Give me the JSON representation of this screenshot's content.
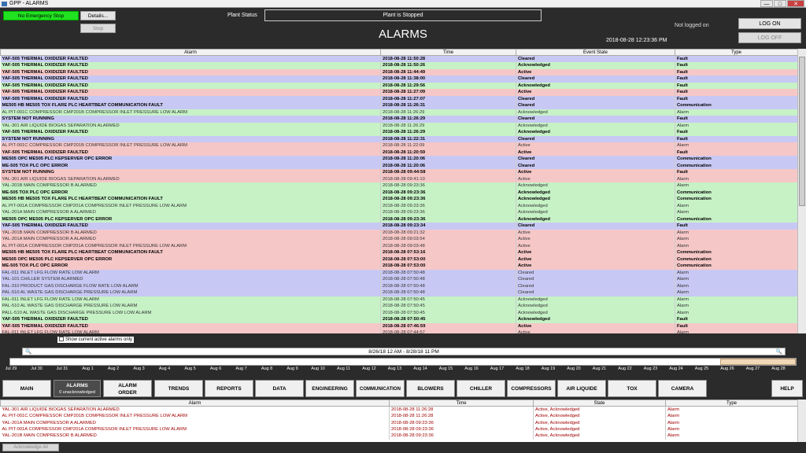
{
  "window": {
    "title": "GPP - ALARMS",
    "min": "—",
    "max": "□",
    "close": "✕"
  },
  "header": {
    "estop": "No Emergency Stop",
    "details": "Details...",
    "stop": "Stop",
    "plant_status_label": "Plant Status",
    "plant_status": "Plant is Stopped",
    "title": "ALARMS",
    "datetime": "2018-08-28 12:23:36 PM",
    "login_status": "Not logged on",
    "log_on": "LOG ON",
    "log_off": "LOG OFF"
  },
  "alarm_table": {
    "columns": [
      "Alarm",
      "Time",
      "Event State",
      "Type"
    ],
    "rows": [
      {
        "alarm": "YAF-505 THERMAL OXIDIZER FAULTED",
        "time": "2018-08-28 11:50:28",
        "state": "Cleared",
        "type": "Fault",
        "c": "clr",
        "b": 1
      },
      {
        "alarm": "YAF-505 THERMAL OXIDIZER FAULTED",
        "time": "2018-08-28 11:50:26",
        "state": "Acknowledged",
        "type": "Fault",
        "c": "ack",
        "b": 1
      },
      {
        "alarm": "YAF-505 THERMAL OXIDIZER FAULTED",
        "time": "2018-08-28 11:44:49",
        "state": "Active",
        "type": "Fault",
        "c": "act",
        "b": 1
      },
      {
        "alarm": "YAF-505 THERMAL OXIDIZER FAULTED",
        "time": "2018-08-28 11:38:00",
        "state": "Cleared",
        "type": "Fault",
        "c": "clr",
        "b": 1
      },
      {
        "alarm": "YAF-505 THERMAL OXIDIZER FAULTED",
        "time": "2018-08-28 11:29:56",
        "state": "Acknowledged",
        "type": "Fault",
        "c": "ack",
        "b": 1
      },
      {
        "alarm": "YAF-505 THERMAL OXIDIZER FAULTED",
        "time": "2018-08-28 11:27:09",
        "state": "Active",
        "type": "Fault",
        "c": "act",
        "b": 1
      },
      {
        "alarm": "YAF-505 THERMAL OXIDIZER FAULTED",
        "time": "2018-08-28 11:27:07",
        "state": "Cleared",
        "type": "Fault",
        "c": "clr",
        "b": 1
      },
      {
        "alarm": "ME505 HB ME505 TOX FLARE PLC HEARTBEAT COMMUNICATION FAULT",
        "time": "2018-08-28 11:26:31",
        "state": "Cleared",
        "type": "Communication",
        "c": "clr",
        "b": 1
      },
      {
        "alarm": "AL PIT-001C COMPRESSOR CMP201B COMPRESSOR INLET PRESSURE LOW ALARM",
        "time": "2018-08-28 11:26:29",
        "state": "Acknowledged",
        "type": "Alarm",
        "c": "ack",
        "b": 0
      },
      {
        "alarm": "SYSTEM NOT RUNNING",
        "time": "2018-08-28 11:26:29",
        "state": "Cleared",
        "type": "Fault",
        "c": "clr",
        "b": 1
      },
      {
        "alarm": "YAL-301 AIR LIQUIDE BIOGAS SEPARATION ALARMED",
        "time": "2018-08-28 11:26:29",
        "state": "Acknowledged",
        "type": "Alarm",
        "c": "ack",
        "b": 0
      },
      {
        "alarm": "YAF-505 THERMAL OXIDIZER FAULTED",
        "time": "2018-08-28 11:26:29",
        "state": "Acknowledged",
        "type": "Fault",
        "c": "ack",
        "b": 1
      },
      {
        "alarm": "SYSTEM NOT RUNNING",
        "time": "2018-08-28 11:22:31",
        "state": "Cleared",
        "type": "Fault",
        "c": "clr",
        "b": 1
      },
      {
        "alarm": "AL PIT-001C COMPRESSOR CMP201B COMPRESSOR INLET PRESSURE LOW ALARM",
        "time": "2018-08-28 11:22:09",
        "state": "Active",
        "type": "Alarm",
        "c": "act",
        "b": 0
      },
      {
        "alarm": "YAF-505 THERMAL OXIDIZER FAULTED",
        "time": "2018-08-28 11:20:59",
        "state": "Active",
        "type": "Fault",
        "c": "act",
        "b": 1
      },
      {
        "alarm": "ME505 OPC ME505 PLC KEPSERVER OPC ERROR",
        "time": "2018-08-28 11:20:06",
        "state": "Cleared",
        "type": "Communication",
        "c": "clr",
        "b": 1
      },
      {
        "alarm": "ME-505 TOX PLC OPC ERROR",
        "time": "2018-08-28 11:20:06",
        "state": "Cleared",
        "type": "Communication",
        "c": "clr",
        "b": 1
      },
      {
        "alarm": "SYSTEM NOT RUNNING",
        "time": "2018-08-28 09:44:58",
        "state": "Active",
        "type": "Fault",
        "c": "act",
        "b": 1
      },
      {
        "alarm": "YAL-301 AIR LIQUIDE BIOGAS SEPARATION ALARMED",
        "time": "2018-08-28 09:41:10",
        "state": "Active",
        "type": "Alarm",
        "c": "act",
        "b": 0
      },
      {
        "alarm": "YAL-201B MAIN COMPRESSOR B ALARMED",
        "time": "2018-08-28 09:23:36",
        "state": "Acknowledged",
        "type": "Alarm",
        "c": "ack",
        "b": 0
      },
      {
        "alarm": "ME-505 TOX PLC OPC ERROR",
        "time": "2018-08-28 09:23:36",
        "state": "Acknowledged",
        "type": "Communication",
        "c": "ack",
        "b": 1
      },
      {
        "alarm": "ME505 HB ME505 TOX FLARE PLC HEARTBEAT COMMUNICATION FAULT",
        "time": "2018-08-28 09:23:36",
        "state": "Acknowledged",
        "type": "Communication",
        "c": "ack",
        "b": 1
      },
      {
        "alarm": "AL PIT-001A COMPRESSOR CMP201A COMPRESSOR INLET PRESSURE LOW ALARM",
        "time": "2018-08-28 09:23:36",
        "state": "Acknowledged",
        "type": "Alarm",
        "c": "ack",
        "b": 0
      },
      {
        "alarm": "YAL-201A MAIN COMPRESSOR A ALARMED",
        "time": "2018-08-28 09:23:36",
        "state": "Acknowledged",
        "type": "Alarm",
        "c": "ack",
        "b": 0
      },
      {
        "alarm": "ME505 OPC ME505 PLC KEPSERVER OPC ERROR",
        "time": "2018-08-28 09:23:36",
        "state": "Acknowledged",
        "type": "Communication",
        "c": "ack",
        "b": 1
      },
      {
        "alarm": "YAF-505 THERMAL OXIDIZER FAULTED",
        "time": "2018-08-28 09:23:34",
        "state": "Cleared",
        "type": "Fault",
        "c": "clr",
        "b": 1
      },
      {
        "alarm": "YAL-201B MAIN COMPRESSOR B ALARMED",
        "time": "2018-08-28 09:21:32",
        "state": "Active",
        "type": "Alarm",
        "c": "act",
        "b": 0
      },
      {
        "alarm": "YAL-201A MAIN COMPRESSOR A ALARMED",
        "time": "2018-08-28 09:03:54",
        "state": "Active",
        "type": "Alarm",
        "c": "act",
        "b": 0
      },
      {
        "alarm": "AL PIT-001A COMPRESSOR CMP201A COMPRESSOR INLET PRESSURE LOW ALARM",
        "time": "2018-08-28 09:03:48",
        "state": "Active",
        "type": "Alarm",
        "c": "act",
        "b": 0
      },
      {
        "alarm": "ME505 HB ME505 TOX FLARE PLC HEARTBEAT COMMUNICATION FAULT",
        "time": "2018-08-28 07:53:16",
        "state": "Active",
        "type": "Communication",
        "c": "act",
        "b": 1
      },
      {
        "alarm": "ME505 OPC ME505 PLC KEPSERVER OPC ERROR",
        "time": "2018-08-28 07:53:00",
        "state": "Active",
        "type": "Communication",
        "c": "act",
        "b": 1
      },
      {
        "alarm": "ME-505 TOX PLC OPC ERROR",
        "time": "2018-08-28 07:53:00",
        "state": "Active",
        "type": "Communication",
        "c": "act",
        "b": 1
      },
      {
        "alarm": "FAL-011 INLET LFG FLOW RATE LOW ALARM",
        "time": "2018-08-28 07:50:48",
        "state": "Cleared",
        "type": "Alarm",
        "c": "clr",
        "b": 0
      },
      {
        "alarm": "YAL-101 CHILLER SYSTEM ALARMED",
        "time": "2018-08-28 07:50:48",
        "state": "Cleared",
        "type": "Alarm",
        "c": "clr",
        "b": 0
      },
      {
        "alarm": "FAL-310 PRODUCT GAS DISCHARGE FLOW RATE  LOW ALARM",
        "time": "2018-08-28 07:50:48",
        "state": "Cleared",
        "type": "Alarm",
        "c": "clr",
        "b": 0
      },
      {
        "alarm": "PAL-510 AL WASTE GAS DISCHARGE PRESSURE  LOW ALARM",
        "time": "2018-08-28 07:50:48",
        "state": "Cleared",
        "type": "Alarm",
        "c": "clr",
        "b": 0
      },
      {
        "alarm": "FAL-011 INLET LFG FLOW RATE LOW ALARM",
        "time": "2018-08-28 07:50:45",
        "state": "Acknowledged",
        "type": "Alarm",
        "c": "ack",
        "b": 0
      },
      {
        "alarm": "PAL-510 AL WASTE GAS DISCHARGE PRESSURE  LOW ALARM",
        "time": "2018-08-28 07:50:45",
        "state": "Acknowledged",
        "type": "Alarm",
        "c": "ack",
        "b": 0
      },
      {
        "alarm": "PALL-510 AL WASTE GAS DISCHARGE PRESSURE  LOW LOW ALARM",
        "time": "2018-08-28 07:50:45",
        "state": "Acknowledged",
        "type": "Alarm",
        "c": "ack",
        "b": 0
      },
      {
        "alarm": "YAF-505 THERMAL OXIDIZER FAULTED",
        "time": "2018-08-28 07:50:45",
        "state": "Acknowledged",
        "type": "Fault",
        "c": "ack",
        "b": 1
      },
      {
        "alarm": "YAF-505 THERMAL OXIDIZER FAULTED",
        "time": "2018-08-28 07:46:59",
        "state": "Active",
        "type": "Fault",
        "c": "act",
        "b": 1
      },
      {
        "alarm": "FAL-011 INLET LFG FLOW RATE LOW ALARM",
        "time": "2018-08-28 07:44:57",
        "state": "Active",
        "type": "Alarm",
        "c": "act",
        "b": 0
      }
    ]
  },
  "show_active_label": "Show current active alarms only",
  "time_range": "8/26/18 12 AM - 8/28/18 11 PM",
  "timeline_ticks": [
    "Jul 29",
    "Jul 30",
    "Jul 31",
    "Aug 1",
    "Aug 2",
    "Aug 3",
    "Aug 4",
    "Aug 5",
    "Aug 6",
    "Aug 7",
    "Aug 8",
    "Aug 9",
    "Aug 10",
    "Aug 11",
    "Aug 12",
    "Aug 13",
    "Aug 14",
    "Aug 15",
    "Aug 16",
    "Aug 17",
    "Aug 18",
    "Aug 19",
    "Aug 20",
    "Aug 21",
    "Aug 22",
    "Aug 23",
    "Aug 24",
    "Aug 25",
    "Aug 26",
    "Aug 27",
    "Aug 28"
  ],
  "nav": {
    "main": "MAIN",
    "alarms": "ALARMS",
    "alarms_sub": "0 unacknowledged",
    "alarm_order_1": "ALARM",
    "alarm_order_2": "ORDER",
    "trends": "TRENDS",
    "reports": "REPORTS",
    "data": "DATA",
    "engineering": "ENGINEERING",
    "communication": "COMMUNICATION",
    "blowers": "BLOWERS",
    "chiller": "CHILLER",
    "compressors": "COMPRESSORS",
    "air_liquide": "AIR LIQUIDE",
    "tox": "TOX",
    "camera": "CAMERA",
    "help": "HELP"
  },
  "recent_table": {
    "columns": [
      "Alarm",
      "Time",
      "State",
      "Type"
    ],
    "rows": [
      {
        "alarm": "YAL-301 AIR LIQUIDE BIOGAS SEPARATION ALARMED",
        "time": "2018-08-28 11:26:28",
        "state": "Active, Acknowledged",
        "type": "Alarm"
      },
      {
        "alarm": "AL PIT-001C COMPRESSOR CMP201B COMPRESSOR INLET PRESSURE LOW ALARM",
        "time": "2018-08-28 11:26:28",
        "state": "Active, Acknowledged",
        "type": "Alarm"
      },
      {
        "alarm": "YAL-201A MAIN COMPRESSOR A ALARMED",
        "time": "2018-08-28 09:23:36",
        "state": "Active, Acknowledged",
        "type": "Alarm"
      },
      {
        "alarm": "AL PIT-001A COMPRESSOR CMP201A COMPRESSOR INLET PRESSURE LOW ALARM",
        "time": "2018-08-28 09:23:36",
        "state": "Active, Acknowledged",
        "type": "Alarm"
      },
      {
        "alarm": "YAL-201B MAIN COMPRESSOR B ALARMED",
        "time": "2018-08-28 09:23:36",
        "state": "Active, Acknowledged",
        "type": "Alarm"
      }
    ]
  },
  "ack_all": "Acknowledge All"
}
